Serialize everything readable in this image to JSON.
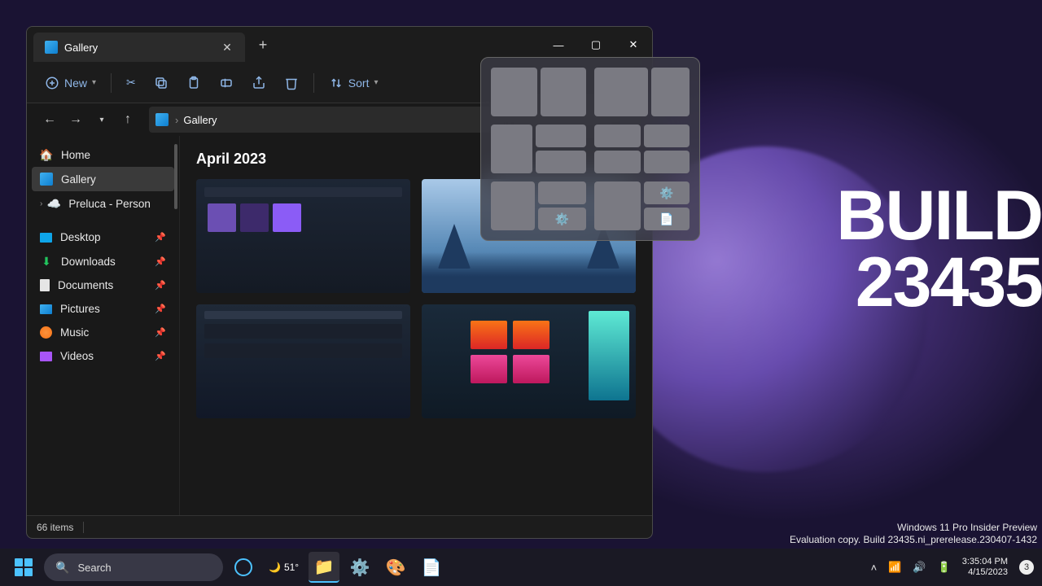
{
  "window": {
    "tab_title": "Gallery",
    "newtab": "+",
    "controls": {
      "min": "—",
      "max": "▢",
      "close": "✕"
    }
  },
  "toolbar": {
    "new": "New",
    "sort": "Sort"
  },
  "address": {
    "segments": [
      "Gallery"
    ]
  },
  "sidebar": {
    "home": "Home",
    "gallery": "Gallery",
    "onedrive": "Preluca - Person",
    "desktop": "Desktop",
    "downloads": "Downloads",
    "documents": "Documents",
    "pictures": "Pictures",
    "music": "Music",
    "videos": "Videos"
  },
  "content": {
    "section": "April 2023"
  },
  "statusbar": {
    "count": "66 items"
  },
  "overlay": {
    "line1": "BUILD",
    "line2": "23435"
  },
  "watermark": {
    "line1": "Windows 11 Pro Insider Preview",
    "line2": "Evaluation copy. Build 23435.ni_prerelease.230407-1432"
  },
  "taskbar": {
    "search_placeholder": "Search",
    "temp": "51°",
    "time": "3:35:04 PM",
    "date": "4/15/2023",
    "notif_count": "3"
  }
}
